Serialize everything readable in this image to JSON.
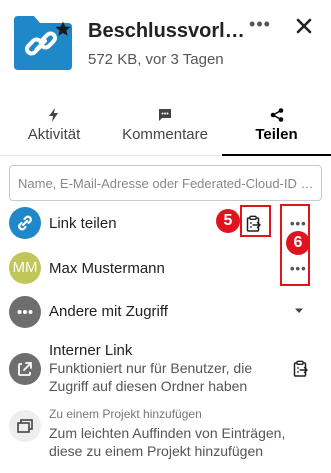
{
  "header": {
    "title": "Beschlussvorl…",
    "subtitle": "572 KB, vor 3 Tagen",
    "more_label": "•••"
  },
  "tabs": [
    {
      "label": "Aktivität",
      "icon": "lightning-icon",
      "active": false
    },
    {
      "label": "Kommentare",
      "icon": "comment-icon",
      "active": false
    },
    {
      "label": "Teilen",
      "icon": "share-icon",
      "active": true
    }
  ],
  "search": {
    "placeholder": "Name, E-Mail-Adresse oder Federated-Cloud-ID …",
    "value": ""
  },
  "shares": {
    "link": {
      "label": "Link teilen",
      "more": "•••"
    },
    "user": {
      "initials": "MM",
      "label": "Max Mustermann",
      "more": "•••"
    },
    "others": {
      "label": "Andere mit Zugriff"
    }
  },
  "internal_link": {
    "title": "Interner Link",
    "description": "Funktioniert nur für Benutzer, die Zugriff auf diesen Ordner haben"
  },
  "project": {
    "small_label": "Zu einem Projekt hinzufügen",
    "description": "Zum leichten Auffinden von Einträgen, diese zu einem Projekt hinzufügen"
  },
  "annotations": {
    "badge_5": "5",
    "badge_6": "6"
  },
  "colors": {
    "accent": "#1e88c8",
    "folder": "#1e88c8",
    "annotation": "#e0141e",
    "user_avatar": "#c1c65a"
  }
}
